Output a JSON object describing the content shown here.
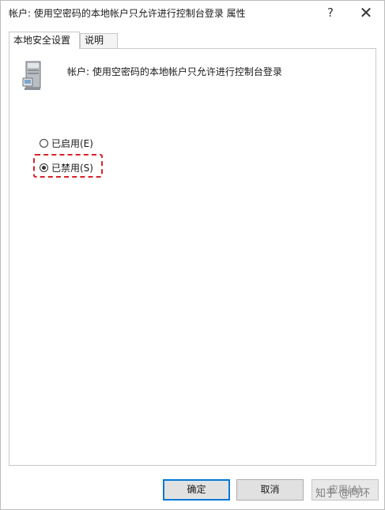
{
  "window": {
    "title": "帐户: 使用空密码的本地帐户只允许进行控制台登录 属性",
    "help_label": "?",
    "close_label": "✕"
  },
  "tabs": [
    {
      "label": "本地安全设置",
      "active": true
    },
    {
      "label": "说明",
      "active": false
    }
  ],
  "policy": {
    "name": "帐户: 使用空密码的本地帐户只允许进行控制台登录",
    "icon": "server-computer-icon"
  },
  "options": [
    {
      "label": "已启用(E)",
      "checked": false
    },
    {
      "label": "已禁用(S)",
      "checked": true
    }
  ],
  "buttons": {
    "ok": "确定",
    "cancel": "取消",
    "apply": "应用(A)"
  },
  "watermark": "知乎 @阿环",
  "colors": {
    "highlight": "#d9202a",
    "default_button_border": "#0078d7"
  }
}
